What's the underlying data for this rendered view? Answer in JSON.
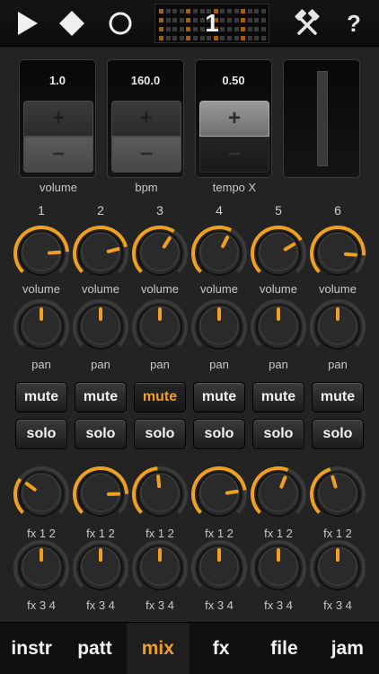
{
  "toolbar": {
    "pattern_number": "1",
    "help_label": "?",
    "icons": [
      "play-icon",
      "stop-icon",
      "record-icon",
      "tools-icon"
    ]
  },
  "master": {
    "volume": {
      "value": "1.0",
      "label": "volume"
    },
    "bpm": {
      "value": "160.0",
      "label": "bpm"
    },
    "tempo": {
      "value": "0.50",
      "label": "tempo X"
    },
    "plus_label": "+",
    "minus_label": "−"
  },
  "channels": [
    {
      "number": "1",
      "volume_label": "volume",
      "pan_label": "pan",
      "mute_label": "mute",
      "solo_label": "solo",
      "fx12_label": "fx 1 2",
      "fx34_label": "fx 3 4",
      "volume_level": 0.82,
      "pan_level": 0.5,
      "fx12_level": 0.3,
      "fx34_level": 0.5,
      "mute_active": false
    },
    {
      "number": "2",
      "volume_label": "volume",
      "pan_label": "pan",
      "mute_label": "mute",
      "solo_label": "solo",
      "fx12_label": "fx 1 2",
      "fx34_label": "fx 3 4",
      "volume_level": 0.78,
      "pan_level": 0.5,
      "fx12_level": 0.83,
      "fx34_level": 0.5,
      "mute_active": false
    },
    {
      "number": "3",
      "volume_label": "volume",
      "pan_label": "pan",
      "mute_label": "mute",
      "solo_label": "solo",
      "fx12_label": "fx 1 2",
      "fx34_label": "fx 3 4",
      "volume_level": 0.62,
      "pan_level": 0.5,
      "fx12_level": 0.48,
      "fx34_level": 0.5,
      "mute_active": true
    },
    {
      "number": "4",
      "volume_label": "volume",
      "pan_label": "pan",
      "mute_label": "mute",
      "solo_label": "solo",
      "fx12_label": "fx 1 2",
      "fx34_label": "fx 3 4",
      "volume_level": 0.6,
      "pan_level": 0.5,
      "fx12_level": 0.8,
      "fx34_level": 0.5,
      "mute_active": false
    },
    {
      "number": "5",
      "volume_label": "volume",
      "pan_label": "pan",
      "mute_label": "mute",
      "solo_label": "solo",
      "fx12_label": "fx 1 2",
      "fx34_label": "fx 3 4",
      "volume_level": 0.72,
      "pan_level": 0.5,
      "fx12_level": 0.58,
      "fx34_level": 0.5,
      "mute_active": false
    },
    {
      "number": "6",
      "volume_label": "volume",
      "pan_label": "pan",
      "mute_label": "mute",
      "solo_label": "solo",
      "fx12_label": "fx 1 2",
      "fx34_label": "fx 3 4",
      "volume_level": 0.85,
      "pan_level": 0.5,
      "fx12_level": 0.44,
      "fx34_level": 0.5,
      "mute_active": false
    }
  ],
  "tabs": [
    {
      "label": "instr",
      "active": false
    },
    {
      "label": "patt",
      "active": false
    },
    {
      "label": "mix",
      "active": true
    },
    {
      "label": "fx",
      "active": false
    },
    {
      "label": "file",
      "active": false
    },
    {
      "label": "jam",
      "active": false
    }
  ],
  "colors": {
    "accent": "#f0a020",
    "background": "#232323",
    "knob_body": "#2a2a2a"
  }
}
